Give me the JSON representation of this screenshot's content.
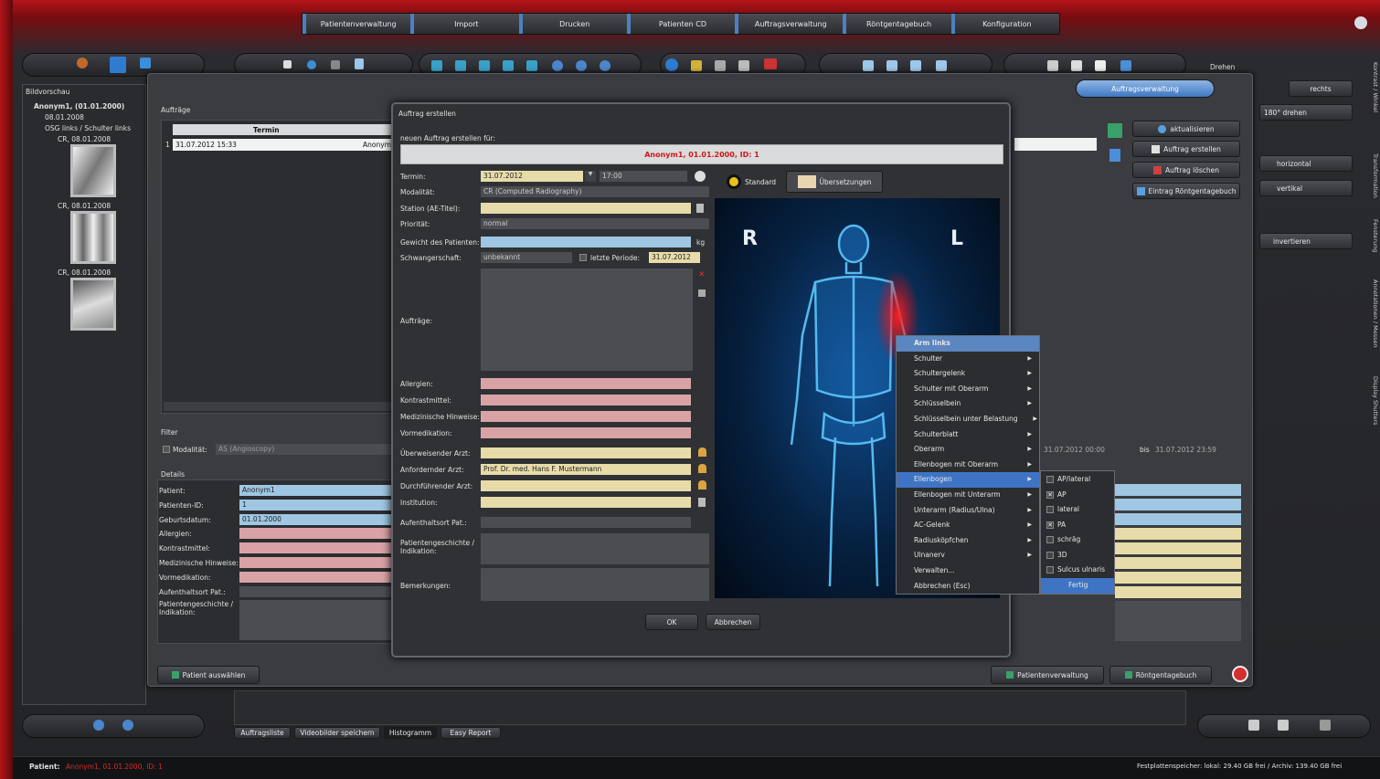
{
  "nav": {
    "tabs": [
      "Patientenverwaltung",
      "Import",
      "Drucken",
      "Patienten CD",
      "Auftragsverwaltung",
      "Röntgentagebuch",
      "Konfiguration"
    ]
  },
  "left": {
    "title": "Bildvorschau",
    "patient": "Anonym1, (01.01.2000)",
    "date": "08.01.2008",
    "study": "OSG links / Schulter links",
    "images": [
      "CR, 08.01.2008",
      "CR, 08.01.2008",
      "CR, 08.01.2008"
    ]
  },
  "main": {
    "header_button": "Auftragsverwaltung",
    "auftraege_label": "Aufträge",
    "col_termin": "Termin",
    "row": {
      "num": "1",
      "date": "31.07.2012  15:33",
      "name": "Anonym"
    },
    "filter_label": "Filter",
    "modalitaet_label": "Modalität:",
    "modalitaet_value": "AS (Angioscopy)",
    "details_label": "Details",
    "details": [
      {
        "label": "Patient:",
        "value": "Anonym1"
      },
      {
        "label": "Patienten-ID:",
        "value": "1"
      },
      {
        "label": "Geburtsdatum:",
        "value": "01.01.2000"
      },
      {
        "label": "Allergien:",
        "value": ""
      },
      {
        "label": "Kontrastmittel:",
        "value": ""
      },
      {
        "label": "Medizinische Hinweise:",
        "value": ""
      },
      {
        "label": "Vormedikation:",
        "value": ""
      },
      {
        "label": "Aufenthaltsort Pat.:",
        "value": ""
      },
      {
        "label": "Patientengeschichte / Indikation:",
        "value": ""
      }
    ],
    "side_buttons": [
      "aktualisieren",
      "Auftrag erstellen",
      "Auftrag löschen",
      "Eintrag Röntgentagebuch"
    ],
    "date_from": "31.07.2012  00:00",
    "date_to_label": "bis",
    "date_to": "31.07.2012  23:59",
    "bottom_left_button": "Patient auswählen",
    "bottom_right_buttons": [
      "Patientenverwaltung",
      "Röntgentagebuch"
    ]
  },
  "right": {
    "label": "Drehen",
    "buttons": [
      "rechts",
      "180° drehen",
      "horizontal",
      "vertikal",
      "invertieren"
    ],
    "vtabs": [
      "Kontrast / Winkel",
      "Transformation",
      "Fensterung",
      "Annotationen / Messen",
      "Display Shutters"
    ]
  },
  "dialog": {
    "title": "Auftrag erstellen",
    "subtitle": "neuen Auftrag erstellen für:",
    "patient_banner": "Anonym1, 01.01.2000, ID: 1",
    "fields": [
      {
        "label": "Termin:",
        "value": "31.07.2012"
      },
      {
        "label": "Modalität:",
        "value": "CR (Computed Radiography)"
      },
      {
        "label": "Station (AE-Titel):",
        "value": ""
      },
      {
        "label": "Priorität:",
        "value": "normal"
      },
      {
        "label": "Gewicht des Patienten:",
        "value": ""
      },
      {
        "label": "Schwangerschaft:",
        "value": "unbekannt"
      }
    ],
    "time_value": "17:00",
    "kg_unit": "kg",
    "last_period_label": "letzte Periode:",
    "last_period_value": "31.07.2012",
    "auftraege_label": "Aufträge:",
    "fields2": [
      {
        "label": "Allergien:"
      },
      {
        "label": "Kontrastmittel:"
      },
      {
        "label": "Medizinische Hinweise:"
      },
      {
        "label": "Vormedikation:"
      }
    ],
    "fields3": [
      {
        "label": "Überweisender Arzt:",
        "value": ""
      },
      {
        "label": "Anfordernder Arzt:",
        "value": "Prof. Dr. med. Hans F. Mustermann"
      },
      {
        "label": "Durchführender Arzt:",
        "value": ""
      },
      {
        "label": "Institution:",
        "value": ""
      }
    ],
    "aufenthalt_label": "Aufenthaltsort Pat.:",
    "geschichte_label": "Patientengeschichte / Indikation:",
    "bemerkungen_label": "Bemerkungen:",
    "tab_standard": "Standard",
    "tab_uebersetzungen": "Übersetzungen",
    "body_R": "R",
    "body_L": "L",
    "ok": "OK",
    "cancel": "Abbrechen"
  },
  "context_menu": {
    "header": "Arm links",
    "items": [
      "Schulter",
      "Schultergelenk",
      "Schulter mit Oberarm",
      "Schlüsselbein",
      "Schlüsselbein unter Belastung",
      "Schulterblatt",
      "Oberarm",
      "Ellenbogen mit Oberarm",
      "Ellenbogen",
      "Ellenbogen mit Unterarm",
      "Unterarm (Radius/Ulna)",
      "AC-Gelenk",
      "Radiusköpfchen",
      "Ulnanerv",
      "Verwalten...",
      "Abbrechen (Esc)"
    ],
    "highlighted": "Ellenbogen"
  },
  "submenu": {
    "items": [
      {
        "label": "AP/lateral",
        "checked": false
      },
      {
        "label": "AP",
        "checked": true
      },
      {
        "label": "lateral",
        "checked": false
      },
      {
        "label": "PA",
        "checked": true
      },
      {
        "label": "schräg",
        "checked": false
      },
      {
        "label": "3D",
        "checked": false
      },
      {
        "label": "Sulcus ulnaris",
        "checked": false
      }
    ],
    "done": "Fertig"
  },
  "bottom_tabs": [
    "Auftragsliste",
    "Videobilder speichern",
    "Histogramm",
    "Easy Report"
  ],
  "status": {
    "patient_label": "Patient:",
    "patient_value": "Anonym1, 01.01.2000, ID: 1",
    "disk": "Festplattenspeicher: lokal: 29.40 GB frei / Archiv: 139.40 GB frei"
  }
}
